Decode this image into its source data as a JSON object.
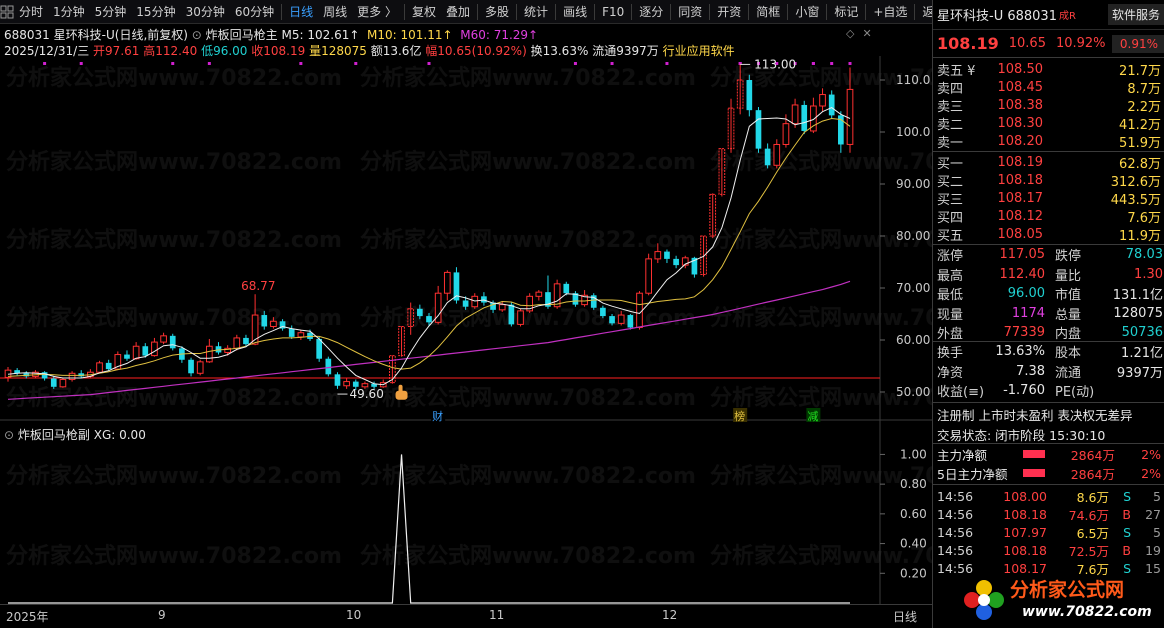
{
  "toolbar": {
    "items": [
      "分时",
      "1分钟",
      "5分钟",
      "15分钟",
      "30分钟",
      "60分钟",
      "日线",
      "周线",
      "更多 〉",
      "复权",
      "叠加",
      "多股",
      "统计",
      "画线",
      "F10",
      "逐分",
      "同资",
      "开资",
      "简框",
      "小窗",
      "标记",
      "+自选",
      "返回"
    ],
    "active_index": 6
  },
  "header": {
    "code": "688031",
    "name": "星环科技-U",
    "period": "(日线,前复权)",
    "indicator": "炸板回马枪主",
    "ma5": "M5: 102.61↑",
    "ma10": "M10: 101.11↑",
    "ma60": "M60: 71.29↑",
    "date": "2025/12/31/三",
    "open": "开97.61",
    "high": "高112.40",
    "low": "低96.00",
    "close": "收108.19",
    "volume": "量128075",
    "amount": "额13.6亿",
    "range": "幅10.65(10.92%)",
    "turnover": "换13.63%",
    "float": "流通9397万",
    "industry": "行业应用软件"
  },
  "price_axis": [
    "110.0",
    "100.0",
    "90.00",
    "80.00",
    "70.00",
    "60.00",
    "50.00"
  ],
  "annotations": {
    "high_label": "113.00",
    "peak_label": "68.77",
    "low_label": "49.60"
  },
  "markers": {
    "cai": "财",
    "bang": "榜",
    "jian": "减"
  },
  "sub_chart": {
    "title": "炸板回马枪副",
    "value": "XG: 0.00",
    "axis": [
      "1.00",
      "0.80",
      "0.60",
      "0.40",
      "0.20"
    ]
  },
  "date_axis": {
    "labels": [
      "2025年",
      "9",
      "10",
      "11",
      "12"
    ],
    "period": "日线"
  },
  "watermark": "分析家公式网www.70822.com",
  "chart_data": {
    "type": "candlestick",
    "ylim": [
      47,
      116
    ],
    "price_ticks": [
      110,
      100,
      90,
      80,
      70,
      60,
      50
    ],
    "bars": [
      [
        52.8,
        54.2,
        52.0,
        54.8
      ],
      [
        54.2,
        53.6,
        53.2,
        54.6
      ],
      [
        53.6,
        53.0,
        52.6,
        54.0
      ],
      [
        53.0,
        53.8,
        52.6,
        54.2
      ],
      [
        53.8,
        52.6,
        52.2,
        54.0
      ],
      [
        52.6,
        51.0,
        50.6,
        53.0
      ],
      [
        51.0,
        52.4,
        50.8,
        52.8
      ],
      [
        52.4,
        53.6,
        52.0,
        54.0
      ],
      [
        53.6,
        53.0,
        52.6,
        54.2
      ],
      [
        53.0,
        53.8,
        52.6,
        54.4
      ],
      [
        53.8,
        55.6,
        53.6,
        56.0
      ],
      [
        55.6,
        54.4,
        54.0,
        56.2
      ],
      [
        54.4,
        57.2,
        54.2,
        57.8
      ],
      [
        57.2,
        56.4,
        56.0,
        58.0
      ],
      [
        56.4,
        58.8,
        56.2,
        59.6
      ],
      [
        58.8,
        57.0,
        56.6,
        59.4
      ],
      [
        57.0,
        59.6,
        56.8,
        60.4
      ],
      [
        59.6,
        60.8,
        59.2,
        61.4
      ],
      [
        60.8,
        58.4,
        58.0,
        61.2
      ],
      [
        58.4,
        56.2,
        55.6,
        58.8
      ],
      [
        56.2,
        53.6,
        53.0,
        56.6
      ],
      [
        53.6,
        55.8,
        53.2,
        56.2
      ],
      [
        55.8,
        58.8,
        55.6,
        60.2
      ],
      [
        58.8,
        57.6,
        57.2,
        59.6
      ],
      [
        57.6,
        58.4,
        57.0,
        59.0
      ],
      [
        58.4,
        60.4,
        58.0,
        61.0
      ],
      [
        60.4,
        59.2,
        58.8,
        61.0
      ],
      [
        59.2,
        64.8,
        59.0,
        68.8
      ],
      [
        64.8,
        62.6,
        62.0,
        65.6
      ],
      [
        62.6,
        63.6,
        62.2,
        64.4
      ],
      [
        63.6,
        62.2,
        61.8,
        64.0
      ],
      [
        62.2,
        60.6,
        60.2,
        62.8
      ],
      [
        60.6,
        61.4,
        60.0,
        62.0
      ],
      [
        61.4,
        60.2,
        59.8,
        62.0
      ],
      [
        60.2,
        56.4,
        55.8,
        60.6
      ],
      [
        56.4,
        53.4,
        53.0,
        56.8
      ],
      [
        53.4,
        51.2,
        50.6,
        53.8
      ],
      [
        51.2,
        52.0,
        50.6,
        52.6
      ],
      [
        52.0,
        51.0,
        50.4,
        52.4
      ],
      [
        51.0,
        51.6,
        50.6,
        52.0
      ],
      [
        51.6,
        51.0,
        50.6,
        52.0
      ],
      [
        51.0,
        51.8,
        50.8,
        52.4
      ],
      [
        51.8,
        57.0,
        51.6,
        57.0
      ],
      [
        57.0,
        62.6,
        56.8,
        62.6
      ],
      [
        62.6,
        66.0,
        61.0,
        67.2
      ],
      [
        66.0,
        64.6,
        64.0,
        66.8
      ],
      [
        64.6,
        63.4,
        62.8,
        65.2
      ],
      [
        63.4,
        69.0,
        63.0,
        70.4
      ],
      [
        69.0,
        73.0,
        67.6,
        73.4
      ],
      [
        73.0,
        67.6,
        67.0,
        74.0
      ],
      [
        67.6,
        66.4,
        65.8,
        68.4
      ],
      [
        66.4,
        68.4,
        66.0,
        69.0
      ],
      [
        68.4,
        67.2,
        66.6,
        69.2
      ],
      [
        67.2,
        65.8,
        65.2,
        67.6
      ],
      [
        65.8,
        66.8,
        65.4,
        67.4
      ],
      [
        66.8,
        63.0,
        62.6,
        67.2
      ],
      [
        63.0,
        65.6,
        62.6,
        66.0
      ],
      [
        65.6,
        68.4,
        65.2,
        69.0
      ],
      [
        68.4,
        69.2,
        67.6,
        69.6
      ],
      [
        69.2,
        66.4,
        66.0,
        72.4
      ],
      [
        66.4,
        70.8,
        66.0,
        71.6
      ],
      [
        70.8,
        69.0,
        68.6,
        71.2
      ],
      [
        69.0,
        66.8,
        66.4,
        69.4
      ],
      [
        66.8,
        68.6,
        66.4,
        69.6
      ],
      [
        68.6,
        66.2,
        65.8,
        69.0
      ],
      [
        66.2,
        64.6,
        64.2,
        66.6
      ],
      [
        64.6,
        63.2,
        62.8,
        65.0
      ],
      [
        63.2,
        64.8,
        62.8,
        65.6
      ],
      [
        64.8,
        62.4,
        62.0,
        65.0
      ],
      [
        62.4,
        69.0,
        62.0,
        69.4
      ],
      [
        69.0,
        75.6,
        68.6,
        76.6
      ],
      [
        75.6,
        77.0,
        74.8,
        78.6
      ],
      [
        77.0,
        75.6,
        74.8,
        77.4
      ],
      [
        75.6,
        74.4,
        73.8,
        76.2
      ],
      [
        74.4,
        75.8,
        73.8,
        76.2
      ],
      [
        75.8,
        72.6,
        72.0,
        76.0
      ],
      [
        72.6,
        80.0,
        72.2,
        80.0
      ],
      [
        80.0,
        88.0,
        79.6,
        88.2
      ],
      [
        88.0,
        96.8,
        87.6,
        96.8
      ],
      [
        96.8,
        104.6,
        96.0,
        106.4
      ],
      [
        104.6,
        110.0,
        103.4,
        113.0
      ],
      [
        110.0,
        104.2,
        103.0,
        111.0
      ],
      [
        104.2,
        96.8,
        96.0,
        104.8
      ],
      [
        96.8,
        93.6,
        93.0,
        97.8
      ],
      [
        93.6,
        97.6,
        93.0,
        98.6
      ],
      [
        97.6,
        101.6,
        97.0,
        103.4
      ],
      [
        101.6,
        105.2,
        100.8,
        106.4
      ],
      [
        105.2,
        100.2,
        99.6,
        106.0
      ],
      [
        100.2,
        105.0,
        99.8,
        106.6
      ],
      [
        105.0,
        107.2,
        104.0,
        108.4
      ],
      [
        107.2,
        103.2,
        102.6,
        108.0
      ],
      [
        103.2,
        97.6,
        96.0,
        104.0
      ],
      [
        97.61,
        108.19,
        96.0,
        112.4
      ]
    ],
    "ma5": [
      53.4,
      53.6,
      53.7,
      53.6,
      53.5,
      53.0,
      52.7,
      52.7,
      52.7,
      53.0,
      53.7,
      54.1,
      54.9,
      55.5,
      56.5,
      56.8,
      57.8,
      58.9,
      59.1,
      58.6,
      57.6,
      56.5,
      56.5,
      56.7,
      57.2,
      58.2,
      58.7,
      60.1,
      61.1,
      61.8,
      62.6,
      62.2,
      61.9,
      61.7,
      60.2,
      58.4,
      56.5,
      54.8,
      53.2,
      52.4,
      51.6,
      51.4,
      52.4,
      54.6,
      57.7,
      60.4,
      62.7,
      64.7,
      67.2,
      68.5,
      68.1,
      67.5,
      67.7,
      67.1,
      66.9,
      66.6,
      66.0,
      66.0,
      66.6,
      66.9,
      67.5,
      68.9,
      68.8,
      68.3,
      68.2,
      67.1,
      66.5,
      66.0,
      65.5,
      65.1,
      67.0,
      69.3,
      71.6,
      72.9,
      74.6,
      75.3,
      76.1,
      77.9,
      81.6,
      87.3,
      94.6,
      101.1,
      102.5,
      102.6,
      102.7,
      102.5,
      101.4,
      101.8,
      102.4,
      103.9,
      104.7,
      103.4,
      102.6
    ],
    "ma10": [
      53.0,
      53.1,
      53.2,
      53.3,
      53.4,
      53.3,
      53.2,
      53.2,
      53.2,
      53.3,
      53.6,
      53.9,
      54.3,
      54.6,
      55.1,
      55.5,
      56.0,
      56.6,
      57.1,
      57.3,
      57.4,
      57.4,
      57.8,
      58.1,
      58.2,
      58.4,
      58.8,
      59.5,
      59.9,
      60.2,
      60.4,
      60.4,
      60.5,
      60.7,
      60.7,
      60.2,
      59.5,
      58.6,
      57.7,
      56.8,
      56.0,
      55.3,
      54.7,
      54.4,
      54.6,
      55.6,
      56.9,
      58.6,
      60.6,
      62.7,
      64.2,
      65.2,
      66.2,
      66.8,
      67.4,
      67.3,
      66.7,
      66.6,
      66.8,
      66.8,
      66.9,
      67.3,
      67.5,
      67.5,
      67.7,
      67.7,
      67.7,
      67.6,
      67.2,
      66.8,
      67.1,
      67.4,
      67.6,
      67.8,
      67.9,
      68.3,
      69.7,
      71.6,
      74.1,
      77.4,
      80.8,
      84.3,
      86.7,
      89.4,
      92.3,
      95.0,
      97.5,
      99.9,
      101.2,
      102.1,
      102.6,
      102.4,
      101.1
    ],
    "ma60": [
      48.6,
      48.7,
      48.8,
      48.9,
      49.0,
      49.1,
      49.2,
      49.3,
      49.4,
      49.5,
      49.7,
      49.9,
      50.1,
      50.3,
      50.5,
      50.7,
      50.9,
      51.1,
      51.3,
      51.5,
      51.7,
      51.9,
      52.1,
      52.3,
      52.5,
      52.7,
      52.9,
      53.1,
      53.3,
      53.5,
      53.7,
      53.9,
      54.1,
      54.3,
      54.5,
      54.7,
      54.9,
      55.1,
      55.3,
      55.5,
      55.7,
      55.9,
      56.1,
      56.3,
      56.5,
      56.7,
      56.9,
      57.1,
      57.3,
      57.5,
      57.7,
      57.9,
      58.1,
      58.3,
      58.5,
      58.7,
      58.9,
      59.1,
      59.3,
      59.5,
      59.8,
      60.1,
      60.4,
      60.7,
      61.0,
      61.3,
      61.6,
      61.9,
      62.2,
      62.5,
      62.8,
      63.1,
      63.4,
      63.7,
      64.0,
      64.3,
      64.6,
      64.9,
      65.3,
      65.7,
      66.1,
      66.5,
      66.9,
      67.3,
      67.7,
      68.1,
      68.5,
      68.9,
      69.3,
      69.7,
      70.2,
      70.7,
      71.29
    ],
    "xg_signal_index": 43
  }
}
